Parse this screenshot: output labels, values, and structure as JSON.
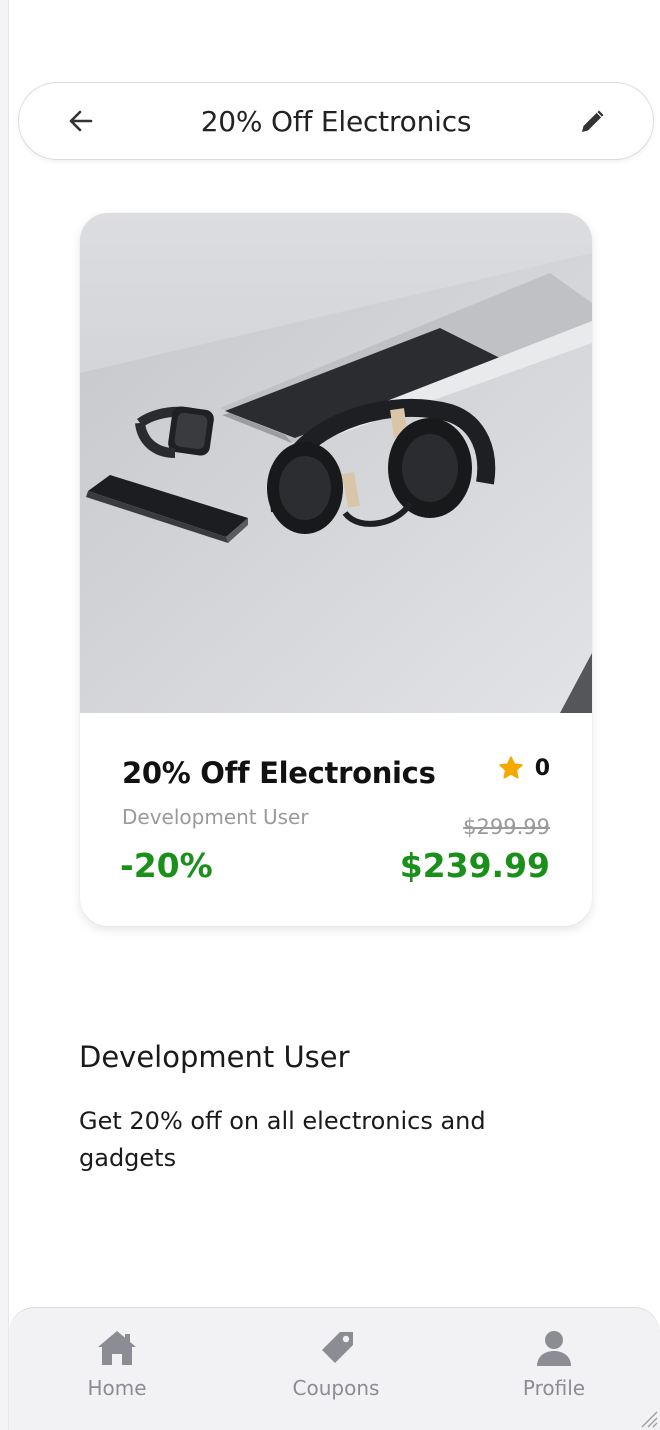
{
  "header": {
    "title": "20% Off Electronics",
    "back_icon": "arrow-left-icon",
    "edit_icon": "pencil-icon"
  },
  "coupon_card": {
    "title": "20% Off Electronics",
    "rating_count": "0",
    "author": "Development User",
    "original_price": "$299.99",
    "discount": "-20%",
    "final_price": "$239.99",
    "image_alt": "headphones, laptop, phone and smartwatch on a desk"
  },
  "details": {
    "merchant": "Development User",
    "description": "Get 20% off on all electronics and gadgets"
  },
  "bottom_nav": {
    "items": [
      {
        "label": "Home",
        "icon": "home-icon"
      },
      {
        "label": "Coupons",
        "icon": "tag-icon"
      },
      {
        "label": "Profile",
        "icon": "user-icon"
      }
    ]
  },
  "colors": {
    "accent_green": "#1a8f1a",
    "star": "#f5a800",
    "muted": "#9a9a9a"
  }
}
